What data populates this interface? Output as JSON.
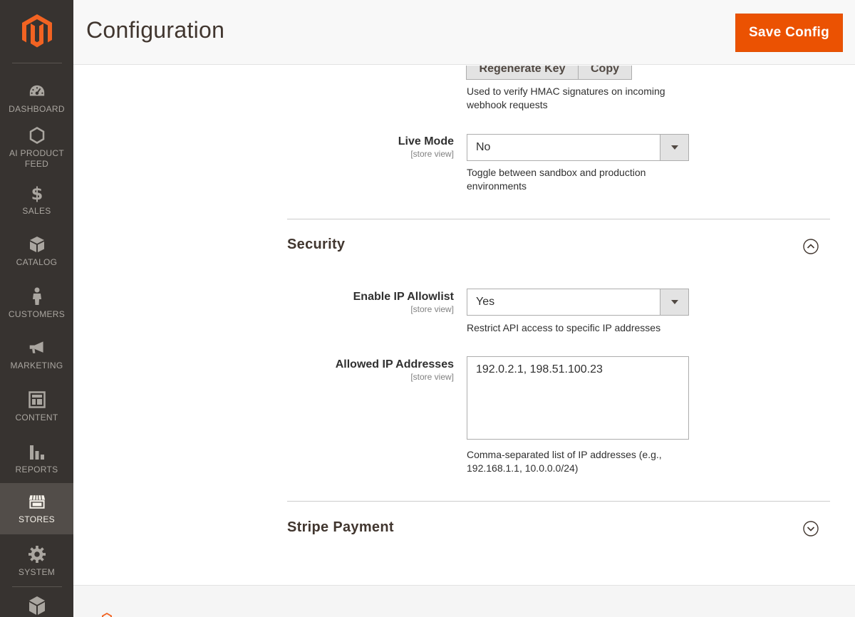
{
  "sidebar": {
    "items": [
      {
        "label": "DASHBOARD",
        "icon": "speedometer-icon"
      },
      {
        "label": "AI PRODUCT FEED",
        "icon": "hexagon-icon"
      },
      {
        "label": "SALES",
        "icon": "dollar-icon"
      },
      {
        "label": "CATALOG",
        "icon": "box-icon"
      },
      {
        "label": "CUSTOMERS",
        "icon": "person-icon"
      },
      {
        "label": "MARKETING",
        "icon": "megaphone-icon"
      },
      {
        "label": "CONTENT",
        "icon": "layout-icon"
      },
      {
        "label": "REPORTS",
        "icon": "bar-chart-icon"
      },
      {
        "label": "STORES",
        "icon": "storefront-icon"
      },
      {
        "label": "SYSTEM",
        "icon": "gear-icon"
      }
    ],
    "active": "STORES",
    "bottom_icon": "cubes-icon"
  },
  "header": {
    "title": "Configuration",
    "save_label": "Save Config"
  },
  "webhook": {
    "regenerate_label": "Regenerate Key",
    "copy_label": "Copy",
    "note": "Used to verify HMAC signatures on incoming webhook requests"
  },
  "live_mode": {
    "label": "Live Mode",
    "scope": "[store view]",
    "value": "No",
    "note": "Toggle between sandbox and production environments"
  },
  "security": {
    "title": "Security",
    "expanded": true,
    "allowlist": {
      "label": "Enable IP Allowlist",
      "scope": "[store view]",
      "value": "Yes",
      "note": "Restrict API access to specific IP addresses"
    },
    "allowed_ips": {
      "label": "Allowed IP Addresses",
      "scope": "[store view]",
      "value": "192.0.2.1, 198.51.100.23",
      "note": "Comma-separated list of IP addresses (e.g., 192.168.1.1, 10.0.0.0/24)"
    }
  },
  "stripe": {
    "title": "Stripe Payment",
    "expanded": false
  },
  "colors": {
    "accent": "#eb5202",
    "sidebar_bg": "#373330",
    "sidebar_active": "#524d49"
  }
}
